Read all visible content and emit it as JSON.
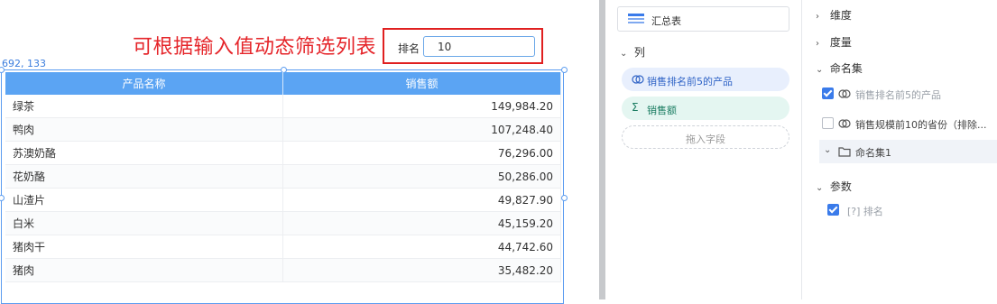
{
  "canvas": {
    "annotation": "可根据输入值动态筛选列表",
    "filter": {
      "label": "排名",
      "value": "10"
    },
    "coords": "692, 133",
    "table": {
      "columns": [
        "产品名称",
        "销售额"
      ],
      "rows": [
        [
          "绿茶",
          "149,984.20"
        ],
        [
          "鸭肉",
          "107,248.40"
        ],
        [
          "苏澳奶酪",
          "76,296.00"
        ],
        [
          "花奶酪",
          "50,286.00"
        ],
        [
          "山渣片",
          "49,827.90"
        ],
        [
          "白米",
          "45,159.20"
        ],
        [
          "猪肉干",
          "44,742.60"
        ],
        [
          "猪肉",
          "35,482.20"
        ]
      ]
    }
  },
  "middle": {
    "summary_button": "汇总表",
    "columns_section": "列",
    "fields": [
      {
        "label": "销售排名前5的产品",
        "kind": "named-set",
        "icon": "link-circles-icon"
      },
      {
        "label": "销售额",
        "kind": "measure",
        "icon": "sigma-icon"
      }
    ],
    "drop_placeholder": "拖入字段"
  },
  "right": {
    "dimension": "维度",
    "measure": "度量",
    "named_sets": "命名集",
    "named_set_items": [
      {
        "label": "销售排名前5的产品",
        "checked": true
      },
      {
        "label": "销售规模前10的省份（排除...",
        "checked": false
      }
    ],
    "folder": "命名集1",
    "params": "参数",
    "param_items": [
      {
        "label": "[?] 排名",
        "checked": true
      }
    ]
  },
  "colors": {
    "accent": "#3a7bea",
    "header": "#5ba4f3",
    "annotation": "#e5252a"
  }
}
